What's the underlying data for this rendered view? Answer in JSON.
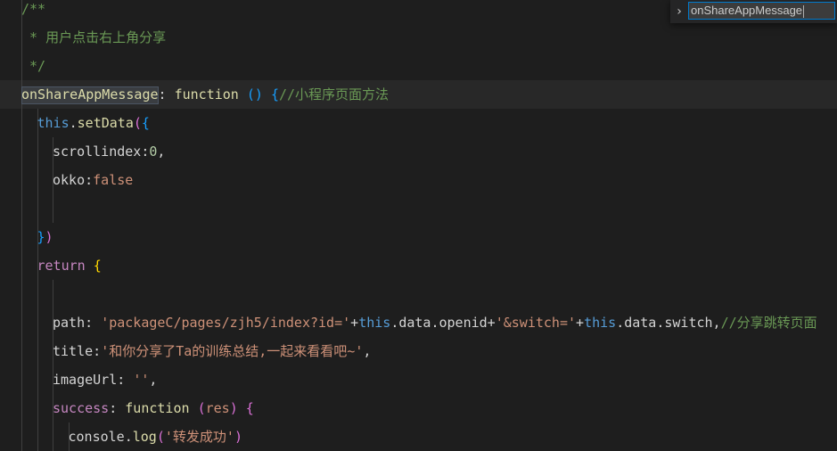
{
  "find_widget": {
    "query": "onShareAppMessage"
  },
  "code_lines": [
    {
      "indent": 1,
      "tokens": [
        {
          "t": "comment",
          "v": "/**"
        }
      ]
    },
    {
      "indent": 1,
      "tokens": [
        {
          "t": "comment",
          "v": " * 用户点击右上角分享"
        }
      ]
    },
    {
      "indent": 1,
      "tokens": [
        {
          "t": "comment",
          "v": " */"
        }
      ]
    },
    {
      "indent": 1,
      "current": true,
      "tokens": [
        {
          "t": "method",
          "v": "onShareAppMessage",
          "match": true
        },
        {
          "t": "plain",
          "v": ": "
        },
        {
          "t": "method",
          "v": "function"
        },
        {
          "t": "plain",
          "v": " "
        },
        {
          "t": "brace2",
          "v": "()"
        },
        {
          "t": "plain",
          "v": " "
        },
        {
          "t": "brace2",
          "v": "{"
        },
        {
          "t": "comment",
          "v": "//小程序页面方法"
        }
      ]
    },
    {
      "indent": 2,
      "tokens": [
        {
          "t": "keyword",
          "v": "this"
        },
        {
          "t": "plain",
          "v": "."
        },
        {
          "t": "method",
          "v": "setData"
        },
        {
          "t": "paren",
          "v": "("
        },
        {
          "t": "brace2",
          "v": "{"
        }
      ]
    },
    {
      "indent": 3,
      "tokens": [
        {
          "t": "prop",
          "v": "scrollindex"
        },
        {
          "t": "plain",
          "v": ":"
        },
        {
          "t": "number",
          "v": "0"
        },
        {
          "t": "plain",
          "v": ","
        }
      ]
    },
    {
      "indent": 3,
      "tokens": [
        {
          "t": "prop",
          "v": "okko"
        },
        {
          "t": "plain",
          "v": ":"
        },
        {
          "t": "string",
          "v": "false"
        }
      ]
    },
    {
      "indent": 3,
      "tokens": []
    },
    {
      "indent": 2,
      "tokens": [
        {
          "t": "brace2",
          "v": "}"
        },
        {
          "t": "paren",
          "v": ")"
        }
      ]
    },
    {
      "indent": 2,
      "tokens": [
        {
          "t": "control",
          "v": "return"
        },
        {
          "t": "plain",
          "v": " "
        },
        {
          "t": "brace",
          "v": "{"
        }
      ]
    },
    {
      "indent": 3,
      "tokens": []
    },
    {
      "indent": 3,
      "tokens": [
        {
          "t": "prop",
          "v": "path"
        },
        {
          "t": "plain",
          "v": ": "
        },
        {
          "t": "string",
          "v": "'packageC/pages/zjh5/index?id='"
        },
        {
          "t": "plain",
          "v": "+"
        },
        {
          "t": "keyword",
          "v": "this"
        },
        {
          "t": "plain",
          "v": ".data.openid+"
        },
        {
          "t": "string",
          "v": "'&switch='"
        },
        {
          "t": "plain",
          "v": "+"
        },
        {
          "t": "keyword",
          "v": "this"
        },
        {
          "t": "plain",
          "v": ".data.switch,"
        },
        {
          "t": "comment",
          "v": "//分享跳转页面"
        }
      ]
    },
    {
      "indent": 3,
      "tokens": [
        {
          "t": "prop",
          "v": "title"
        },
        {
          "t": "plain",
          "v": ":"
        },
        {
          "t": "string",
          "v": "'和你分享了Ta的训练总结,一起来看看吧~'"
        },
        {
          "t": "plain",
          "v": ","
        }
      ]
    },
    {
      "indent": 3,
      "tokens": [
        {
          "t": "prop",
          "v": "imageUrl"
        },
        {
          "t": "plain",
          "v": ": "
        },
        {
          "t": "string",
          "v": "''"
        },
        {
          "t": "plain",
          "v": ","
        }
      ]
    },
    {
      "indent": 3,
      "tokens": [
        {
          "t": "control",
          "v": "success"
        },
        {
          "t": "plain",
          "v": ": "
        },
        {
          "t": "method",
          "v": "function"
        },
        {
          "t": "plain",
          "v": " "
        },
        {
          "t": "paren",
          "v": "("
        },
        {
          "t": "string",
          "v": "res"
        },
        {
          "t": "paren",
          "v": ")"
        },
        {
          "t": "plain",
          "v": " "
        },
        {
          "t": "paren",
          "v": "{"
        }
      ]
    },
    {
      "indent": 4,
      "tokens": [
        {
          "t": "plain",
          "v": "console."
        },
        {
          "t": "method",
          "v": "log"
        },
        {
          "t": "paren",
          "v": "("
        },
        {
          "t": "string",
          "v": "'转发成功'"
        },
        {
          "t": "paren",
          "v": ")"
        }
      ]
    }
  ]
}
